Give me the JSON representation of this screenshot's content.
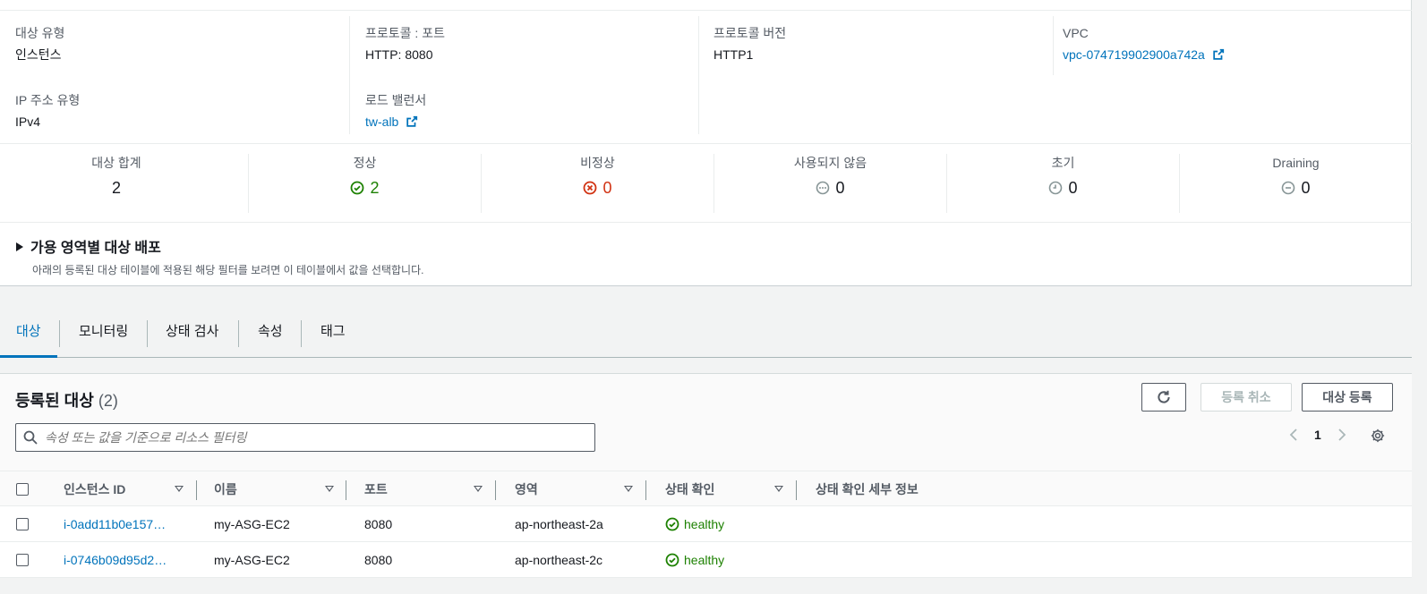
{
  "details": {
    "target_type_label": "대상 유형",
    "target_type_value": "인스턴스",
    "ip_type_label": "IP 주소 유형",
    "ip_type_value": "IPv4",
    "protocol_port_label": "프로토콜 : 포트",
    "protocol_port_value": "HTTP: 8080",
    "load_balancer_label": "로드 밸런서",
    "load_balancer_value": "tw-alb",
    "protocol_version_label": "프로토콜 버전",
    "protocol_version_value": "HTTP1",
    "vpc_label": "VPC",
    "vpc_value": "vpc-074719902900a742a"
  },
  "stats": [
    {
      "label": "대상 합계",
      "value": "2",
      "status": "none"
    },
    {
      "label": "정상",
      "value": "2",
      "status": "ok"
    },
    {
      "label": "비정상",
      "value": "0",
      "status": "bad"
    },
    {
      "label": "사용되지 않음",
      "value": "0",
      "status": "unused"
    },
    {
      "label": "초기",
      "value": "0",
      "status": "initial"
    },
    {
      "label": "Draining",
      "value": "0",
      "status": "draining"
    }
  ],
  "az": {
    "title": "가용 영역별 대상 배포",
    "description": "아래의 등록된 대상 테이블에 적용된 해당 필터를 보려면 이 테이블에서 값을 선택합니다."
  },
  "tabs": [
    "대상",
    "모니터링",
    "상태 검사",
    "속성",
    "태그"
  ],
  "table": {
    "title": "등록된 대상",
    "count": "(2)",
    "deregister_label": "등록 취소",
    "register_label": "대상 등록",
    "search_placeholder": "속성 또는 값을 기준으로 리소스 필터링",
    "page": "1",
    "columns": [
      "인스턴스 ID",
      "이름",
      "포트",
      "영역",
      "상태 확인",
      "상태 확인 세부 정보"
    ],
    "rows": [
      {
        "id": "i-0add11b0e157…",
        "name": "my-ASG-EC2",
        "port": "8080",
        "zone": "ap-northeast-2a",
        "health": "healthy",
        "details": ""
      },
      {
        "id": "i-0746b09d95d2…",
        "name": "my-ASG-EC2",
        "port": "8080",
        "zone": "ap-northeast-2c",
        "health": "healthy",
        "details": ""
      }
    ]
  },
  "colors": {
    "link": "#0073bb",
    "ok": "#1d8102",
    "bad": "#d13212"
  }
}
